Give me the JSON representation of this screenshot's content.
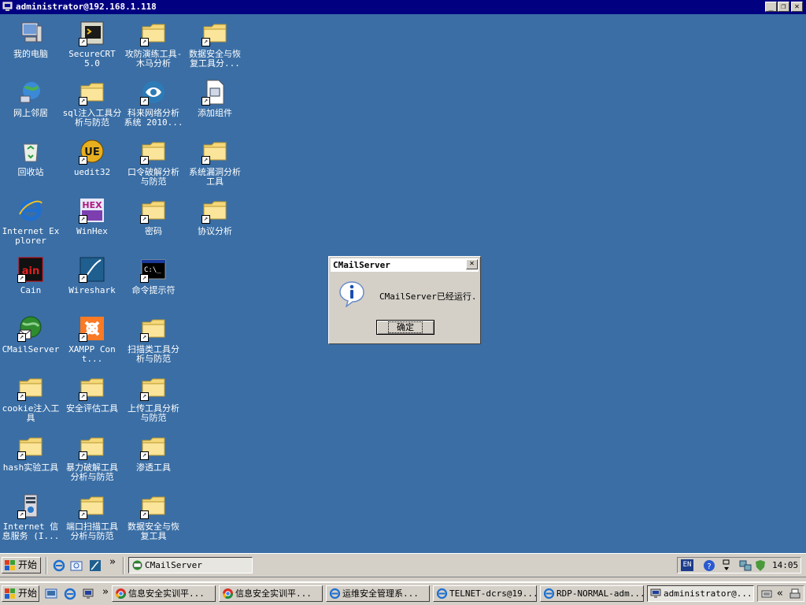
{
  "window": {
    "title": "administrator@192.168.1.118",
    "minimize": "_",
    "restore": "❐",
    "close": "✕"
  },
  "desktop_icons": [
    {
      "label": "我的电脑",
      "icon": "my-computer-icon",
      "shortcut": false
    },
    {
      "label": "SecureCRT 5.0",
      "icon": "securecrt-icon",
      "shortcut": true
    },
    {
      "label": "攻防演练工具-木马分析",
      "icon": "folder-icon",
      "shortcut": true
    },
    {
      "label": "数据安全与恢复工具分...",
      "icon": "folder-icon",
      "shortcut": true
    },
    {
      "label": "网上邻居",
      "icon": "network-places-icon",
      "shortcut": false
    },
    {
      "label": "sql注入工具分析与防范",
      "icon": "folder-icon",
      "shortcut": true
    },
    {
      "label": "科来网络分析系统 2010...",
      "icon": "colasoft-icon",
      "shortcut": true
    },
    {
      "label": "添加组件",
      "icon": "add-components-icon",
      "shortcut": true
    },
    {
      "label": "回收站",
      "icon": "recycle-bin-icon",
      "shortcut": false
    },
    {
      "label": "uedit32",
      "icon": "ultraedit-icon",
      "shortcut": true
    },
    {
      "label": "口令破解分析与防范",
      "icon": "folder-icon",
      "shortcut": true
    },
    {
      "label": "系统漏洞分析工具",
      "icon": "folder-icon",
      "shortcut": true
    },
    {
      "label": "Internet Explorer",
      "icon": "internet-explorer-icon",
      "shortcut": false
    },
    {
      "label": "WinHex",
      "icon": "winhex-icon",
      "shortcut": true
    },
    {
      "label": "密码",
      "icon": "folder-icon",
      "shortcut": true
    },
    {
      "label": "协议分析",
      "icon": "folder-icon",
      "shortcut": true
    },
    {
      "label": "Cain",
      "icon": "cain-icon",
      "shortcut": true
    },
    {
      "label": "Wireshark",
      "icon": "wireshark-icon",
      "shortcut": true
    },
    {
      "label": "命令提示符",
      "icon": "command-prompt-icon",
      "shortcut": true
    },
    {
      "label": "CMailServer",
      "icon": "cmailserver-icon",
      "shortcut": true
    },
    {
      "label": "XAMPP Cont...",
      "icon": "xampp-icon",
      "shortcut": true
    },
    {
      "label": "扫描类工具分析与防范",
      "icon": "folder-icon",
      "shortcut": true
    },
    {
      "label": "cookie注入工具",
      "icon": "folder-icon",
      "shortcut": true
    },
    {
      "label": "安全评估工具",
      "icon": "folder-icon",
      "shortcut": true
    },
    {
      "label": "上传工具分析与防范",
      "icon": "folder-icon",
      "shortcut": true
    },
    {
      "label": "hash实验工具",
      "icon": "folder-icon",
      "shortcut": true
    },
    {
      "label": "暴力破解工具分析与防范",
      "icon": "folder-icon",
      "shortcut": true
    },
    {
      "label": "渗透工具",
      "icon": "folder-icon",
      "shortcut": true
    },
    {
      "label": "Internet 信息服务 (I...",
      "icon": "iis-icon",
      "shortcut": true
    },
    {
      "label": "端口扫描工具分析与防范",
      "icon": "folder-icon",
      "shortcut": true
    },
    {
      "label": "数据安全与恢复工具",
      "icon": "folder-icon",
      "shortcut": true
    }
  ],
  "dialog": {
    "title": "CMailServer",
    "close": "✕",
    "message": "CMailServer已经运行.",
    "ok_label": "确定"
  },
  "remote_taskbar": {
    "start_label": "开始",
    "chevron": "»",
    "task_label": "CMailServer",
    "lang": "EN",
    "clock": "14:05"
  },
  "local_taskbar": {
    "start_label": "开始",
    "tasks": [
      "信息安全实训平...",
      "信息安全实训平...",
      "运维安全管理系...",
      "TELNET-dcrs@19...",
      "RDP-NORMAL-adm...",
      "administrator@..."
    ],
    "chevron": "«"
  },
  "colors": {
    "desktop": "#3a6ea5",
    "titlebar": "#000080",
    "chrome": "#d4d0c8"
  }
}
